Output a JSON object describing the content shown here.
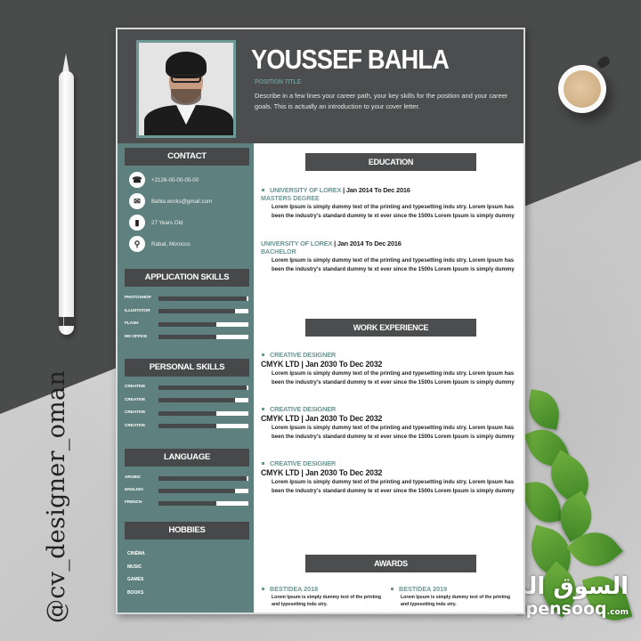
{
  "scene": {
    "watermark_handle": "@cv_designer_oman",
    "opensooq_arabic": "السوق المفتوح",
    "opensooq_latin": "opensooq",
    "opensooq_tld": ".com"
  },
  "colors": {
    "header_dark": "#4b4d4e",
    "sidebar_teal": "#5e807f",
    "accent_teal": "#6b9694",
    "section_head": "#464849"
  },
  "header": {
    "name": "YOUSSEF BAHLA",
    "position_title": "POSITION TITLE",
    "summary": "Describe in a few lines your career path, your key skills for the position and your career goals. This is actually an introduction to your cover letter."
  },
  "sidebar": {
    "contact": {
      "title": "CONTACT",
      "items": [
        {
          "icon": "phone-icon",
          "glyph": "☎",
          "text": "+2126-00-00-00-00"
        },
        {
          "icon": "mail-icon",
          "glyph": "✉",
          "text": "Bahla.works@gmail.com"
        },
        {
          "icon": "person-icon",
          "glyph": "▮",
          "text": "27 Years Old"
        },
        {
          "icon": "location-pin-icon",
          "glyph": "⚲",
          "text": "Rabat, Morocco"
        }
      ]
    },
    "application_skills": {
      "title": "APPLICATION SKILLS",
      "items": [
        {
          "label": "PHOTOSHOP",
          "level": 0.98
        },
        {
          "label": "ILLUSTATOR",
          "level": 0.85
        },
        {
          "label": "FLASH",
          "level": 0.64
        },
        {
          "label": "MS OFFICE",
          "level": 0.64
        }
      ]
    },
    "personal_skills": {
      "title": "PERSONAL SKILLS",
      "items": [
        {
          "label": "CREATIVE",
          "level": 0.98
        },
        {
          "label": "CREATIVE",
          "level": 0.85
        },
        {
          "label": "CREATIVE",
          "level": 0.64
        },
        {
          "label": "CREATIVE",
          "level": 0.64
        }
      ]
    },
    "language": {
      "title": "LANGUAGE",
      "items": [
        {
          "label": "ARABIC",
          "level": 0.98
        },
        {
          "label": "ENGLISH",
          "level": 0.85
        },
        {
          "label": "FRENCH",
          "level": 0.64
        }
      ]
    },
    "hobbies": {
      "title": "HOBBIES",
      "items": [
        "CINÉMA",
        "MUSIC",
        "GAMES",
        "BOOKS"
      ]
    }
  },
  "main": {
    "education": {
      "title": "EDUCATION",
      "items": [
        {
          "school": "UNIVERSITY OF LOREX",
          "dates": "Jan 2014 To Dec 2016",
          "degree": "MASTERS DEGREE",
          "desc": "Lorem Ipsum is simply dummy text of the printing and typesetting indu stry. Lorem Ipsum has been the industry's standard dummy te xt ever since the 1500s Lorem Ipsum is simply dummy"
        },
        {
          "school": "UNIVERSITY OF LOREX",
          "dates": "Jan 2014 To Dec 2016",
          "degree": "BACHELOR",
          "desc": "Lorem Ipsum is simply dummy text of the printing and typesetting indu stry. Lorem Ipsum has been the industry's standard dummy te xt ever since the 1500s Lorem Ipsum is simply dummy"
        }
      ]
    },
    "work": {
      "title": "WORK EXPERIENCE",
      "items": [
        {
          "role": "CREATIVE DESIGNER",
          "company_dates": "CMYK LTD  |  Jan 2030 To Dec 2032",
          "desc": "Lorem Ipsum is simply dummy text of the printing and typesetting indu stry. Lorem Ipsum has been the industry's standard dummy te xt ever since the 1500s Lorem Ipsum is simply dummy"
        },
        {
          "role": "CREATIVE DESIGNER",
          "company_dates": "CMYK LTD  |  Jan 2030 To Dec 2032",
          "desc": "Lorem Ipsum is simply dummy text of the printing and typesetting indu stry. Lorem Ipsum has been the industry's standard dummy te xt ever since the 1500s Lorem Ipsum is simply dummy"
        },
        {
          "role": "CREATIVE DESIGNER",
          "company_dates": "CMYK LTD  |  Jan 2030 To Dec 2032",
          "desc": "Lorem Ipsum is simply dummy text of the printing and typesetting indu stry. Lorem Ipsum has been the industry's standard dummy te xt ever since the 1500s Lorem Ipsum is simply dummy"
        }
      ]
    },
    "awards": {
      "title": "AWARDS",
      "items": [
        {
          "title": "BESTIDEA 2018",
          "desc": "Lorem Ipsum is simply dummy text of the printing and typesetting indu stry."
        },
        {
          "title": "BESTIDEA 2019",
          "desc": "Lorem Ipsum is simply dummy text of the printing and typesetting indu stry."
        }
      ]
    }
  }
}
